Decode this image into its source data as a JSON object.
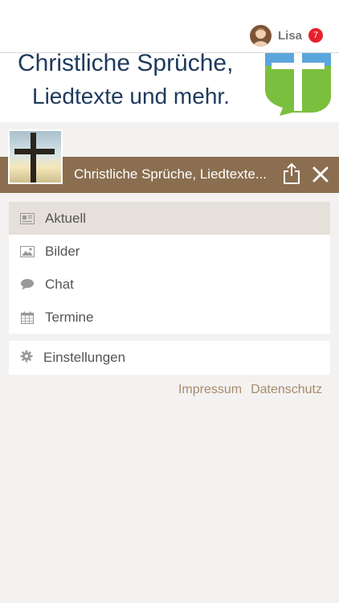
{
  "user": {
    "name": "Lisa",
    "notification_count": "7",
    "avatar_icon": "user-avatar"
  },
  "banner": {
    "line1": "Christliche Sprüche,",
    "line2": "Liedtexte und mehr.",
    "logo_icon": "cross-speech-bubble-logo"
  },
  "header": {
    "title": "Christliche Sprüche, Liedtexte...",
    "share_icon": "share-icon",
    "close_icon": "close-icon",
    "background": "#8a6e4f"
  },
  "menu": {
    "items": [
      {
        "label": "Aktuell",
        "icon": "newspaper-icon",
        "active": true
      },
      {
        "label": "Bilder",
        "icon": "image-icon",
        "active": false
      },
      {
        "label": "Chat",
        "icon": "chat-bubble-icon",
        "active": false
      },
      {
        "label": "Termine",
        "icon": "calendar-icon",
        "active": false
      }
    ]
  },
  "settings": {
    "label": "Einstellungen",
    "icon": "gear-icon"
  },
  "footer": {
    "impressum": "Impressum",
    "datenschutz": "Datenschutz"
  },
  "colors": {
    "accent": "#8a6e4f",
    "link": "#a68b6d",
    "active_row": "#e6e0da",
    "badge": "#e8202c"
  }
}
